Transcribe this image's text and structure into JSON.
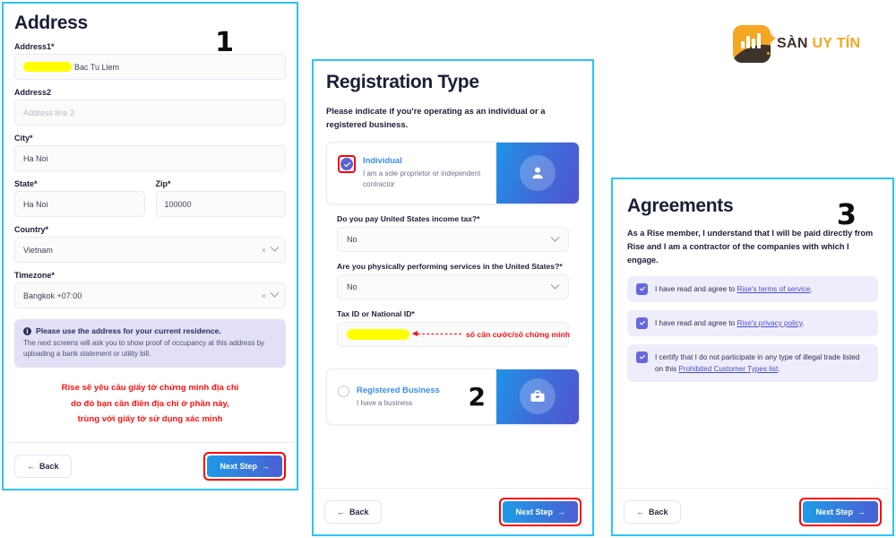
{
  "brand": {
    "name_part1": "SÀN",
    "name_part2": "UY TÍN",
    "mark_color": "#f5a623",
    "mark_dark": "#3e332b",
    "bars": [
      8,
      14,
      11,
      17
    ]
  },
  "panel_address": {
    "step_number": "1",
    "title": "Address",
    "fields": {
      "address1_label": "Address1*",
      "address1_value": "Bac Tu Liem",
      "address1_redacted": true,
      "address2_label": "Address2",
      "address2_placeholder": "Address line 2",
      "city_label": "City*",
      "city_value": "Ha Noi",
      "state_label": "State*",
      "state_value": "Ha Noi",
      "zip_label": "Zip*",
      "zip_value": "100000",
      "country_label": "Country*",
      "country_value": "Vietnam",
      "timezone_label": "Timezone*",
      "timezone_value": "Bangkok +07:00"
    },
    "info": {
      "icon": "info-icon",
      "heading": "Please use the address for your current residence.",
      "body": "The next screens will ask you to show proof of occupancy at this address by uploading a bank statement or utility bill."
    },
    "annotation_lines": [
      "Rise sẽ yêu cầu giấy tờ chứng minh địa chỉ",
      "do đó bạn cần điền địa chỉ ở phần này,",
      "trùng với giấy tờ  sử dụng xác minh"
    ],
    "annotation_color": "#fe1111",
    "back_label": "Back",
    "next_label": "Next Step",
    "next_highlight_color": "#ff0000"
  },
  "panel_registration": {
    "step_number": "2",
    "title": "Registration Type",
    "lead": "Please indicate if you're operating as an individual or a registered business.",
    "individual": {
      "selected": true,
      "icon": "person-icon",
      "title": "Individual",
      "subtitle": "I am a sole proprietor or independent contractor",
      "checkbox_highlight_color": "#ff0000"
    },
    "questions": [
      {
        "label": "Do you pay United States income tax?*",
        "value": "No",
        "icon": "chevron-down-icon"
      },
      {
        "label": "Are you physically performing services in the United States?*",
        "value": "No",
        "icon": "chevron-down-icon"
      }
    ],
    "taxid": {
      "label": "Tax ID or National ID*",
      "value_redacted": true,
      "annotation": "số căn cước/số chứng minh",
      "annotation_color": "#fe1111"
    },
    "business": {
      "selected": false,
      "icon": "briefcase-icon",
      "title": "Registered Business",
      "subtitle": "I have a business"
    },
    "back_label": "Back",
    "next_label": "Next Step"
  },
  "panel_agreements": {
    "step_number": "3",
    "title": "Agreements",
    "lead": "As a Rise member, I understand that I will be paid directly from Rise and I am a contractor of the companies with which I engage.",
    "items": [
      {
        "checked": true,
        "before": "I have read and agree to ",
        "link": "Rise's terms of service",
        "after": "."
      },
      {
        "checked": true,
        "before": "I have read and agree to ",
        "link": "Rise's privacy policy",
        "after": "."
      },
      {
        "checked": true,
        "before": "I certify that I do not participate in any type of illegal trade listed on this ",
        "link": "Prohibited Customer Types list",
        "after": "."
      }
    ],
    "back_label": "Back",
    "next_label": "Next Step"
  },
  "icons": {
    "arrow_left": "←",
    "arrow_right": "→",
    "clear": "×"
  }
}
